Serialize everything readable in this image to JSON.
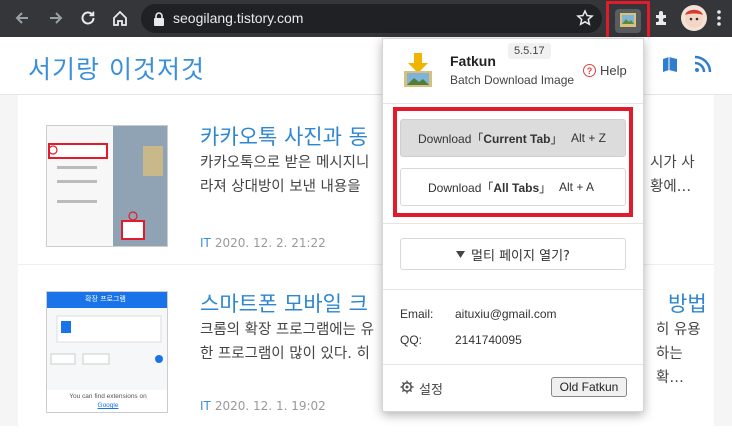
{
  "browser": {
    "url": "seogilang.tistory.com"
  },
  "blog": {
    "title": "서기랑 이것저것"
  },
  "posts": [
    {
      "title": "카카오톡 사진과 동",
      "title_tail": "",
      "excerpt_line1_left": "카카오톡으로 받은 메시지니",
      "excerpt_line1_right": "시가 사",
      "excerpt_line2_left": "라져 상대방이 보낸 내용을",
      "excerpt_line2_right": "황에…",
      "category": "IT",
      "date": "2020. 12. 2. 21:22"
    },
    {
      "title": "스마트폰 모바일 크",
      "title_tail": "방법",
      "excerpt_line1_left": "크롬의 확장 프로그램에는 유",
      "excerpt_line1_right": "히 유용",
      "excerpt_line2_left": "한 프로그램이 많이 있다. 히",
      "excerpt_line2_right": "하는 확…",
      "category": "IT",
      "date": "2020. 12. 1. 19:02"
    }
  ],
  "thumb2_text": {
    "header": "확장 프로그램",
    "line1": "You can find extensions on",
    "line2": "Google"
  },
  "popup": {
    "app_name": "Fatkun",
    "version": "5.5.17",
    "subtitle": "Batch Download Image",
    "help_label": "Help",
    "download_current": {
      "prefix": "Download「",
      "bold": "Current Tab",
      "suffix": "」",
      "shortcut": "Alt + Z"
    },
    "download_all": {
      "prefix": "Download「",
      "bold": "All Tabs",
      "suffix": "」",
      "shortcut": "Alt + A"
    },
    "multi_page_label": "멀티 페이지 열기?",
    "email_label": "Email:",
    "email_value": "aituxiu@gmail.com",
    "qq_label": "QQ:",
    "qq_value": "2141740095",
    "settings_label": "설정",
    "old_button_label": "Old Fatkun"
  },
  "colors": {
    "toolbar": "#35363a",
    "accent_blue": "#3a8fd9",
    "highlight_red": "#e21b2c"
  }
}
